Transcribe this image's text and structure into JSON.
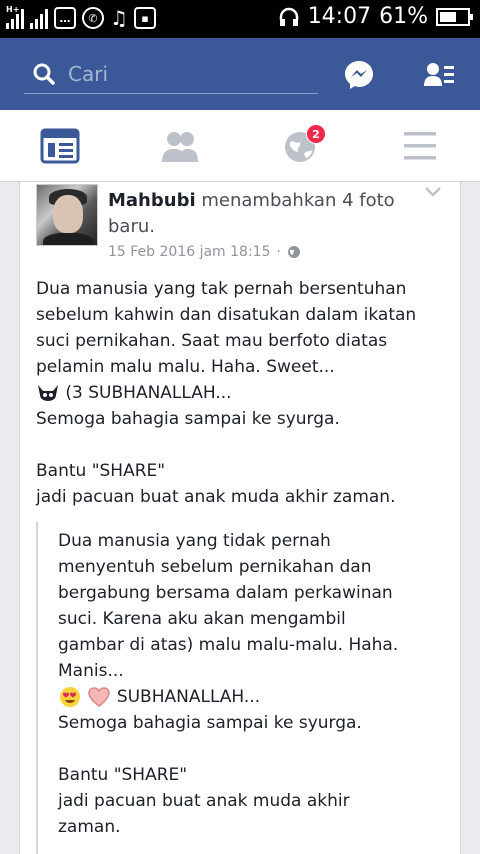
{
  "status_bar": {
    "network_label": "H+",
    "time": "14:07",
    "battery_percent": "61%",
    "battery_level": 0.61
  },
  "header": {
    "search_placeholder": "Cari",
    "brand_color": "#3b5998"
  },
  "tabs": {
    "notification_badge": "2"
  },
  "post": {
    "author": "Mahbubi",
    "action": "menambahkan 4 foto baru.",
    "timestamp": "15 Feb 2016 jam 18:15",
    "separator": "·",
    "lines": [
      "Dua manusia yang tak pernah bersentuhan",
      "sebelum kahwin dan disatukan dalam ikatan",
      "suci pernikahan. Saat mau berfoto diatas",
      "pelamin malu malu. Haha. Sweet..."
    ],
    "emoji_line": "(3 SUBHANALLAH...",
    "line_after_emoji": "Semoga bahagia sampai ke syurga.",
    "share_line_1": "Bantu \"SHARE\"",
    "share_line_2": "jadi pacuan buat anak muda akhir zaman."
  },
  "translation": {
    "lines": [
      "Dua manusia yang tidak pernah",
      "menyentuh sebelum pernikahan dan",
      "bergabung bersama dalam perkawinan",
      "suci. Karena aku akan mengambil",
      "gambar di atas) malu malu-malu. Haha.",
      "Manis..."
    ],
    "emoji_line": "SUBHANALLAH...",
    "line_after_emoji": "Semoga bahagia sampai ke syurga.",
    "share_line_1": "Bantu \"SHARE\"",
    "share_line_2": "jadi pacuan buat anak muda akhir",
    "share_line_3": "zaman."
  }
}
